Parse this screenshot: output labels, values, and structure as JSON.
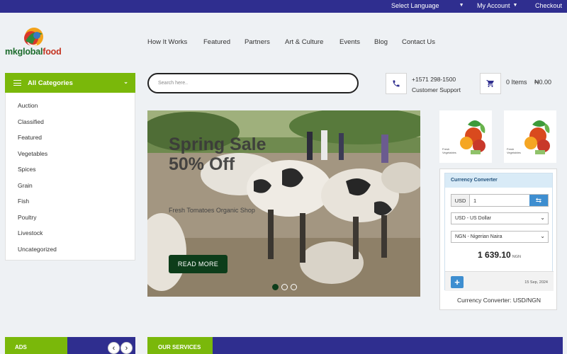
{
  "topbar": {
    "language": "Select Language",
    "account": "My Account",
    "checkout": "Checkout"
  },
  "brand": {
    "name_part1": "mkglobal",
    "name_part2": "food"
  },
  "nav": [
    "How It Works",
    "Featured",
    "Partners",
    "Art & Culture",
    "Events",
    "Blog",
    "Contact Us"
  ],
  "categories": {
    "title": "All Categories",
    "items": [
      "Auction",
      "Classified",
      "Featured",
      "Vegetables",
      "Spices",
      "Grain",
      "Fish",
      "Poultry",
      "Livestock",
      "Uncategorized"
    ]
  },
  "search": {
    "placeholder": "Search here.."
  },
  "support": {
    "phone": "+1571 298-1500",
    "label": "Customer Support"
  },
  "cart": {
    "items": "0 Items",
    "total": "₦0.00"
  },
  "hero": {
    "title_line1": "Spring Sale",
    "title_line2": "50% Off",
    "subtitle": "Fresh Tomatoes Organic Shop",
    "button": "READ MORE",
    "slide_count": 3,
    "active_slide": 1
  },
  "converter": {
    "title": "Currency Converter",
    "from_code": "USD",
    "amount": "1",
    "from_select": "USD - US Dollar",
    "to_select": "NGN - Nigerian Naira",
    "result": "1 639.10",
    "result_unit": "NGN",
    "date": "15 Sep, 2024",
    "caption": "Currency Converter: USD/NGN"
  },
  "bottom": {
    "ads_label": "ADS",
    "services_label": "OUR SERVICES"
  },
  "colors": {
    "brand_blue": "#2f2e8f",
    "brand_green": "#7ab80a",
    "dark_green": "#0d3d1a",
    "accent_blue": "#3e8ed0"
  }
}
